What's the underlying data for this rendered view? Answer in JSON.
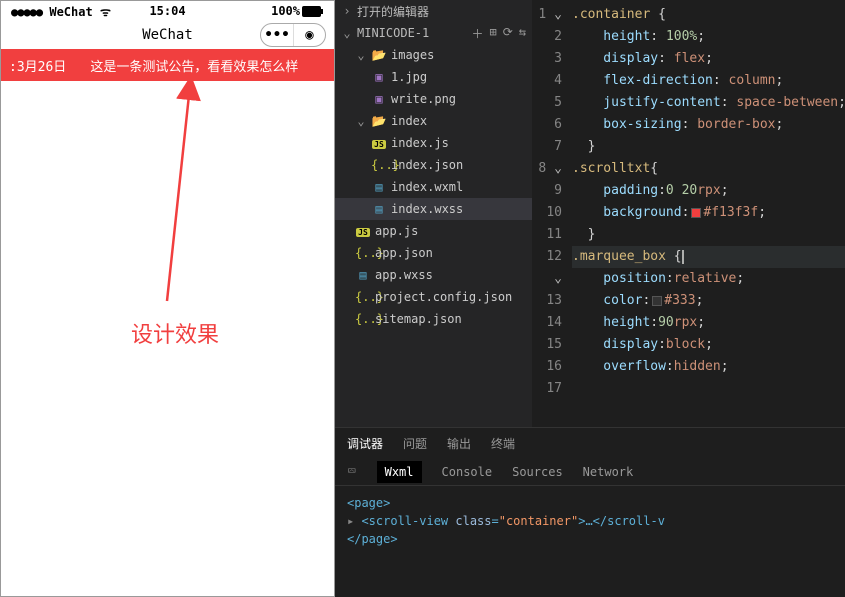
{
  "status": {
    "carrier": "WeChat",
    "time": "15:04",
    "battery": "100%"
  },
  "topbar": {
    "title": "WeChat"
  },
  "banner": {
    "date": ":3月26日",
    "text": "这是一条测试公告，看看效果怎么样"
  },
  "design_label": "设计效果",
  "explorer": {
    "open_editors": "打开的编辑器",
    "project": "MINICODE-1",
    "tree": [
      {
        "lvl": 1,
        "kind": "folder",
        "open": true,
        "label": "images"
      },
      {
        "lvl": 2,
        "kind": "img",
        "label": "1.jpg"
      },
      {
        "lvl": 2,
        "kind": "img",
        "label": "write.png"
      },
      {
        "lvl": 1,
        "kind": "folder",
        "open": true,
        "label": "index"
      },
      {
        "lvl": 2,
        "kind": "js",
        "label": "index.js"
      },
      {
        "lvl": 2,
        "kind": "json",
        "label": "index.json"
      },
      {
        "lvl": 2,
        "kind": "wxml",
        "label": "index.wxml"
      },
      {
        "lvl": 2,
        "kind": "wxss",
        "label": "index.wxss",
        "selected": true
      },
      {
        "lvl": 1,
        "kind": "js",
        "label": "app.js"
      },
      {
        "lvl": 1,
        "kind": "json",
        "label": "app.json"
      },
      {
        "lvl": 1,
        "kind": "wxss",
        "label": "app.wxss"
      },
      {
        "lvl": 1,
        "kind": "json",
        "label": "project.config.json"
      },
      {
        "lvl": 1,
        "kind": "json",
        "label": "sitemap.json"
      }
    ]
  },
  "code": {
    "lines": [
      {
        "n": 1,
        "fold": "v",
        "tokens": [
          [
            "sel-y",
            ".container "
          ],
          [
            "pun",
            "{"
          ]
        ]
      },
      {
        "n": 2,
        "tokens": [
          [
            "prop",
            "    height"
          ],
          [
            "pun",
            ": "
          ],
          [
            "num",
            "100%"
          ],
          [
            "pun",
            ";"
          ]
        ]
      },
      {
        "n": 3,
        "tokens": [
          [
            "prop",
            "    display"
          ],
          [
            "pun",
            ": "
          ],
          [
            "val",
            "flex"
          ],
          [
            "pun",
            ";"
          ]
        ]
      },
      {
        "n": 4,
        "tokens": [
          [
            "prop",
            "    flex-direction"
          ],
          [
            "pun",
            ": "
          ],
          [
            "val",
            "column"
          ],
          [
            "pun",
            ";"
          ]
        ]
      },
      {
        "n": 5,
        "tokens": [
          [
            "prop",
            "    justify-content"
          ],
          [
            "pun",
            ": "
          ],
          [
            "val",
            "space-between"
          ],
          [
            "pun",
            ";"
          ]
        ]
      },
      {
        "n": 6,
        "tokens": [
          [
            "prop",
            "    box-sizing"
          ],
          [
            "pun",
            ": "
          ],
          [
            "val",
            "border-box"
          ],
          [
            "pun",
            ";"
          ]
        ]
      },
      {
        "n": 7,
        "tokens": [
          [
            "pun",
            "  }"
          ]
        ]
      },
      {
        "n": 8,
        "fold": "v",
        "tokens": [
          [
            "sel-y",
            ".scrolltxt"
          ],
          [
            "pun",
            "{"
          ]
        ]
      },
      {
        "n": 9,
        "tokens": [
          [
            "prop",
            "    padding"
          ],
          [
            "pun",
            ":"
          ],
          [
            "num",
            "0 20"
          ],
          [
            "val",
            "rpx"
          ],
          [
            "pun",
            ";"
          ]
        ]
      },
      {
        "n": 10,
        "tokens": [
          [
            "prop",
            "    background"
          ],
          [
            "pun",
            ":"
          ],
          [
            "swatch",
            "red"
          ],
          [
            "val",
            "#f13f3f"
          ],
          [
            "pun",
            ";"
          ]
        ]
      },
      {
        "n": 11,
        "tokens": [
          [
            "pun",
            "  }"
          ]
        ]
      },
      {
        "n": 12,
        "fold": "v",
        "cur": true,
        "tokens": [
          [
            "sel-y",
            ".marquee_box "
          ],
          [
            "pun",
            "{"
          ],
          [
            "caret",
            ""
          ]
        ]
      },
      {
        "n": 13,
        "tokens": [
          [
            "prop",
            "    position"
          ],
          [
            "pun",
            ":"
          ],
          [
            "val",
            "relative"
          ],
          [
            "pun",
            ";"
          ]
        ]
      },
      {
        "n": 14,
        "tokens": [
          [
            "prop",
            "    color"
          ],
          [
            "pun",
            ":"
          ],
          [
            "swatch",
            "dark"
          ],
          [
            "val",
            "#333"
          ],
          [
            "pun",
            ";"
          ]
        ]
      },
      {
        "n": 15,
        "tokens": [
          [
            "prop",
            "    height"
          ],
          [
            "pun",
            ":"
          ],
          [
            "num",
            "90"
          ],
          [
            "val",
            "rpx"
          ],
          [
            "pun",
            ";"
          ]
        ]
      },
      {
        "n": 16,
        "tokens": [
          [
            "prop",
            "    display"
          ],
          [
            "pun",
            ":"
          ],
          [
            "val",
            "block"
          ],
          [
            "pun",
            ";"
          ]
        ]
      },
      {
        "n": 17,
        "tokens": [
          [
            "prop",
            "    overflow"
          ],
          [
            "pun",
            ":"
          ],
          [
            "val",
            "hidden"
          ],
          [
            "pun",
            ";"
          ]
        ]
      }
    ]
  },
  "bottom_tabs": {
    "debugger": "调试器",
    "problems": "问题",
    "output": "输出",
    "terminal": "终端"
  },
  "dev_tabs": {
    "wxml": "Wxml",
    "console": "Console",
    "sources": "Sources",
    "network": "Network"
  },
  "dom": {
    "page_open": "<page>",
    "page_close": "</page>",
    "sv_open": "<scroll-view ",
    "cls": "class",
    "eq": "=",
    "val": "\"container\"",
    "sv_mid": ">…</scroll-v"
  }
}
